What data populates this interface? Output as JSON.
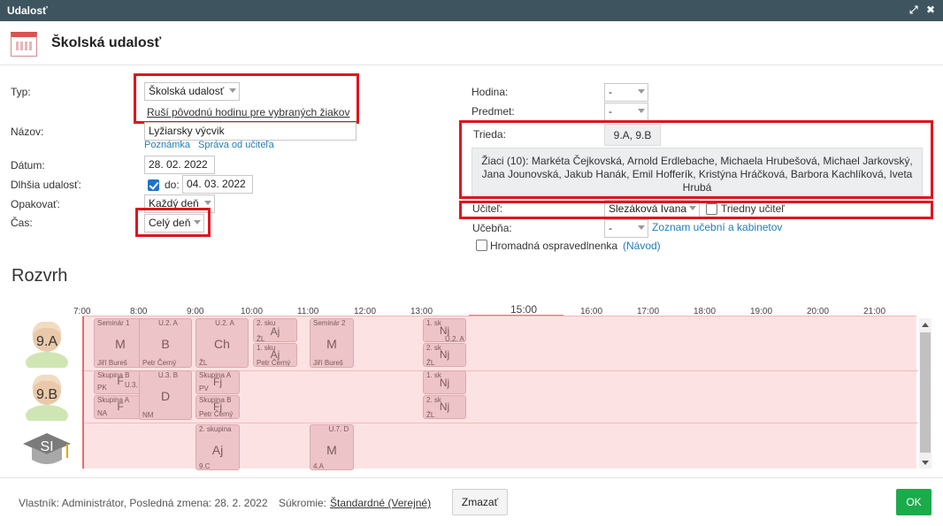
{
  "window": {
    "title": "Udalosť",
    "expand_icon": "⤢",
    "close_icon": "✖"
  },
  "header": {
    "title": "Školská udalosť",
    "icon": "calendar-icon"
  },
  "form_left": {
    "typ_label": "Typ:",
    "typ_value": "Školská udalosť",
    "typ_link": "Ruší pôvodnú hodinu pre vybraných žiakov",
    "nazov_label": "Názov:",
    "nazov_value": "Lyžiarsky výcvik",
    "poznamka_link": "Poznámka",
    "sprava_link": "Správa od učiteľa",
    "datum_label": "Dátum:",
    "datum_value": "28. 02. 2022",
    "dlhsia_label": "Dlhšia udalosť:",
    "do_label": "do:",
    "do_value": "04. 03. 2022",
    "opakovat_label": "Opakovať:",
    "opakovat_value": "Každý deň",
    "cas_label": "Čas:",
    "cas_value": "Celý deň"
  },
  "form_right": {
    "hodina_label": "Hodina:",
    "hodina_value": "-",
    "predmet_label": "Predmet:",
    "predmet_value": "-",
    "trieda_label": "Trieda:",
    "trieda_value": "9.A, 9.B",
    "ziaci_text": "Žiaci (10): Markéta Čejkovská, Arnold Erdlebache, Michaela Hrubešová, Michael Jarkovský, Jana Jounovská, Jakub Hanák, Emil Hofferík, Kristýna Hráčková, Barbora Kachlíková, Iveta Hrubá",
    "ucitel_label": "Učiteľ:",
    "ucitel_value": "Slezáková Ivana",
    "triedny_label": "Triedny učiteľ",
    "ucebna_label": "Učebňa:",
    "ucebna_value": "-",
    "ucebna_link": "Zoznam učební a kabinetov",
    "hromadna_label": "Hromadná ospravedlnenka",
    "navod_link": "(Návod)"
  },
  "rozvrh": {
    "title": "Rozvrh",
    "hours": [
      "7:00",
      "8:00",
      "9:00",
      "10:00",
      "11:00",
      "12:00",
      "13:00",
      "16:00",
      "17:00",
      "18:00",
      "19:00",
      "20:00",
      "21:00"
    ],
    "now_label": "15:00",
    "rows": [
      {
        "label": "9.A",
        "icon": "student-girl-icon"
      },
      {
        "label": "9.B",
        "icon": "student-girl-icon"
      },
      {
        "label": "SI",
        "icon": "graduation-cap-icon"
      }
    ],
    "lessons": {
      "a1": {
        "room": "Seminár 1",
        "subj": "M",
        "teacher": "Jiří Bureš"
      },
      "a2": {
        "room": "U.2. A",
        "subj": "B",
        "teacher": "Petr Černý"
      },
      "a3": {
        "room": "U.2. A",
        "subj": "Ch",
        "teacher": "ŽL"
      },
      "a4": {
        "room": "2. sku",
        "subj": "Aj",
        "teacher": "ŽL"
      },
      "a4b": {
        "room": "1. sku",
        "subj": "Aj",
        "teacher": "Petr Černý"
      },
      "a5": {
        "room": "Seminár 2",
        "subj": "M",
        "teacher": "Jiří Bureš"
      },
      "a6": {
        "room": "1. sk",
        "subj": "Nj",
        "teacher": "U.2. A"
      },
      "a6b": {
        "room": "2. sk",
        "subj": "Nj",
        "teacher": "ŽL"
      },
      "b1": {
        "room": "Skupina B",
        "subj": "F",
        "teacher": "PK"
      },
      "b1b": {
        "room": "Skupina A",
        "subj": "F",
        "teacher": "NA"
      },
      "b1c": {
        "room": "U.3. B",
        "subj": "",
        "teacher": ""
      },
      "b2": {
        "room": "U.3. B",
        "subj": "D",
        "teacher": "NM"
      },
      "b3": {
        "room": "Skupina A",
        "subj": "Fj",
        "teacher": "PV"
      },
      "b3b": {
        "room": "Skupina B",
        "subj": "Fj",
        "teacher": "Petr Černý"
      },
      "b4": {
        "room": "1. sk",
        "subj": "Nj",
        "teacher": ""
      },
      "b4b": {
        "room": "2. sk",
        "subj": "Nj",
        "teacher": "ŽL"
      },
      "s1": {
        "room": "2. skupina",
        "subj": "Aj",
        "teacher": "9.C"
      },
      "s2": {
        "room": "U.7. D",
        "subj": "M",
        "teacher": "4.A"
      }
    }
  },
  "footer": {
    "vlastnik": "Vlastník: Administrátor, Posledná zmena: 28. 2. 2022",
    "sukromie_label": "Súkromie:",
    "sukromie_value": "Štandardné (Verejné)",
    "delete_label": "Zmazať",
    "ok_label": "OK"
  }
}
